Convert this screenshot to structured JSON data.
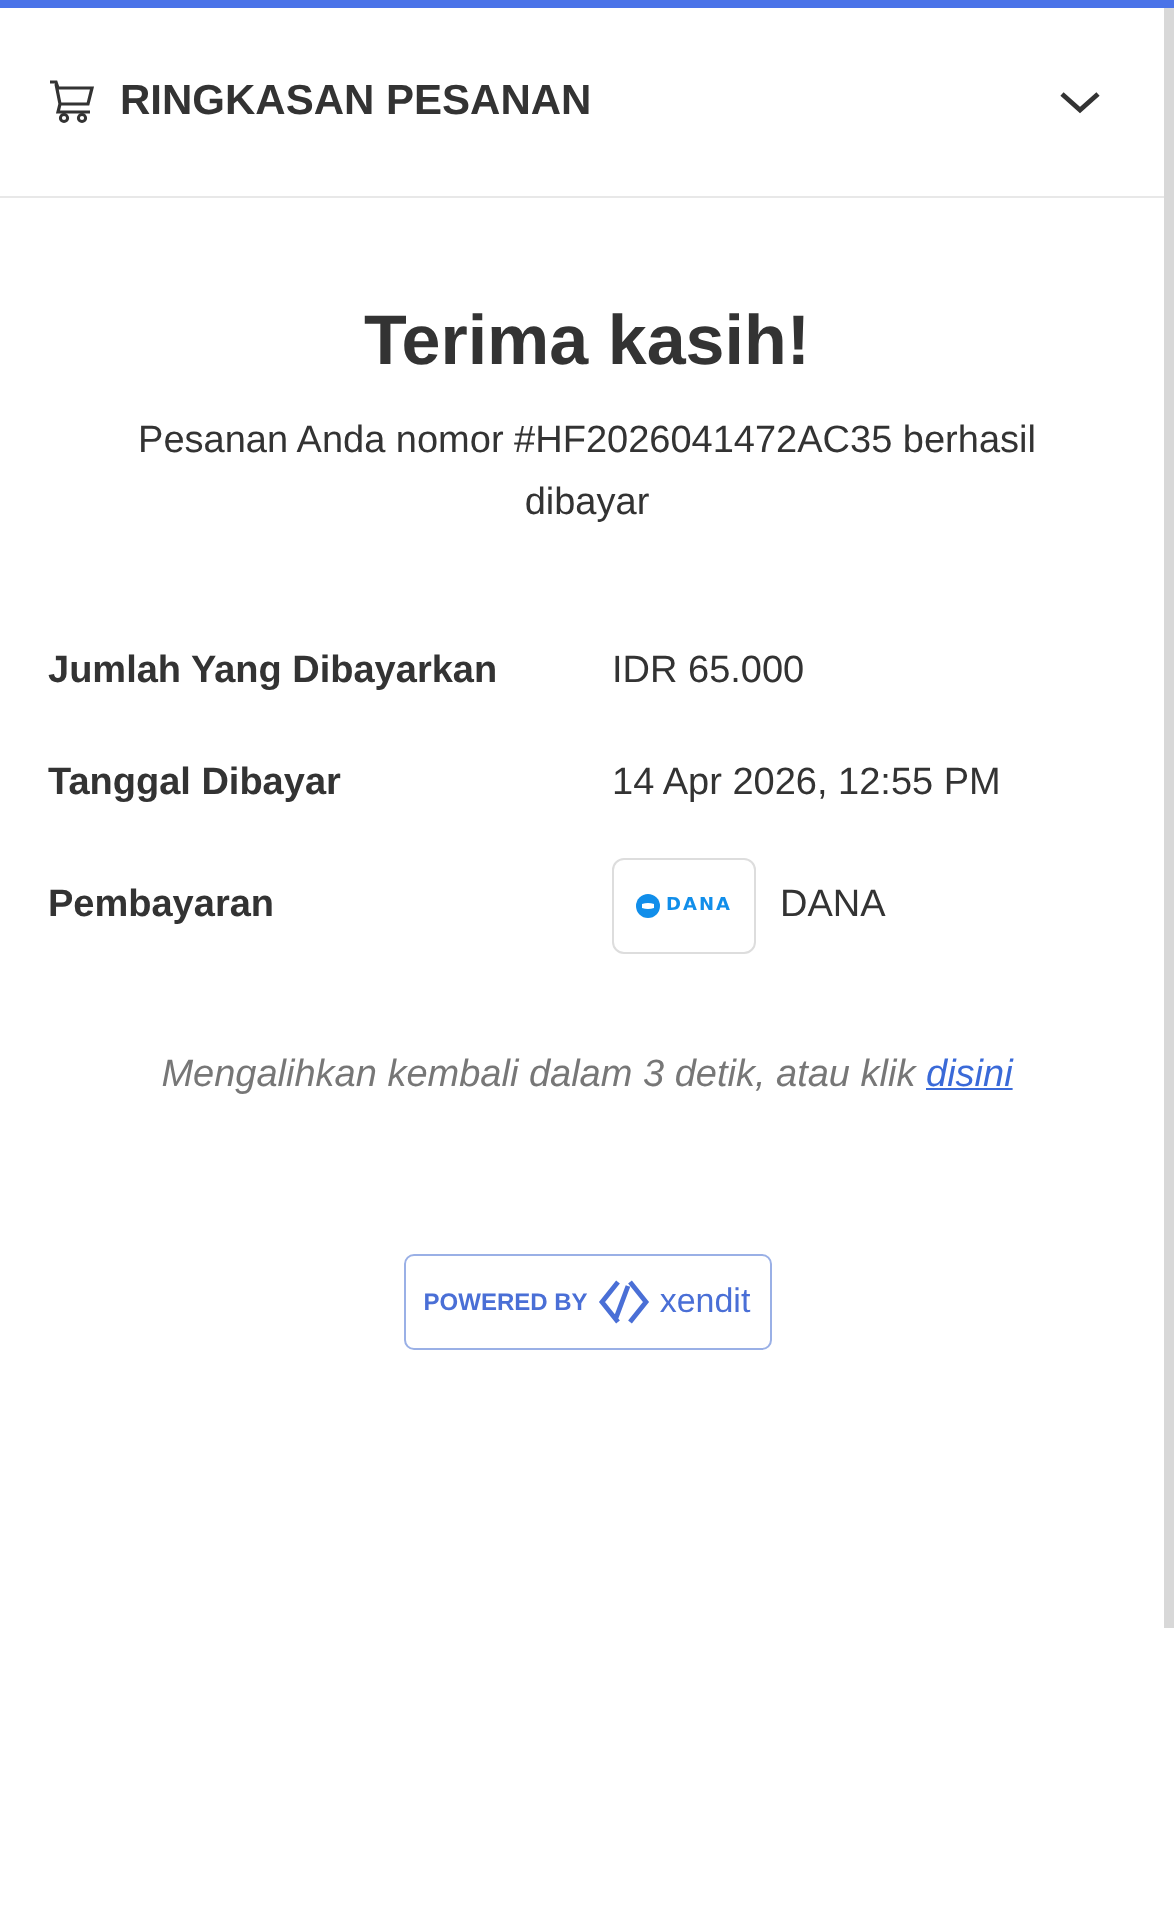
{
  "header": {
    "title": "RINGKASAN PESANAN",
    "expanded": false
  },
  "thanks": {
    "title": "Terima kasih!",
    "message": "Pesanan Anda nomor #HF2026041472AC35 berhasil dibayar"
  },
  "details": [
    {
      "kind": "text",
      "label": "Jumlah Yang Dibayarkan",
      "value": "IDR 65.000"
    },
    {
      "kind": "text",
      "label": "Tanggal Dibayar",
      "value": "14 Apr 2026, 12:55 PM"
    },
    {
      "kind": "payment",
      "label": "Pembayaran",
      "logo_text": "DANA",
      "value": "DANA"
    }
  ],
  "redirect": {
    "text": "Mengalihkan kembali dalam 3 detik, atau klik",
    "link": "disini"
  },
  "powered": {
    "label": "POWERED BY",
    "brand": "xendit"
  }
}
